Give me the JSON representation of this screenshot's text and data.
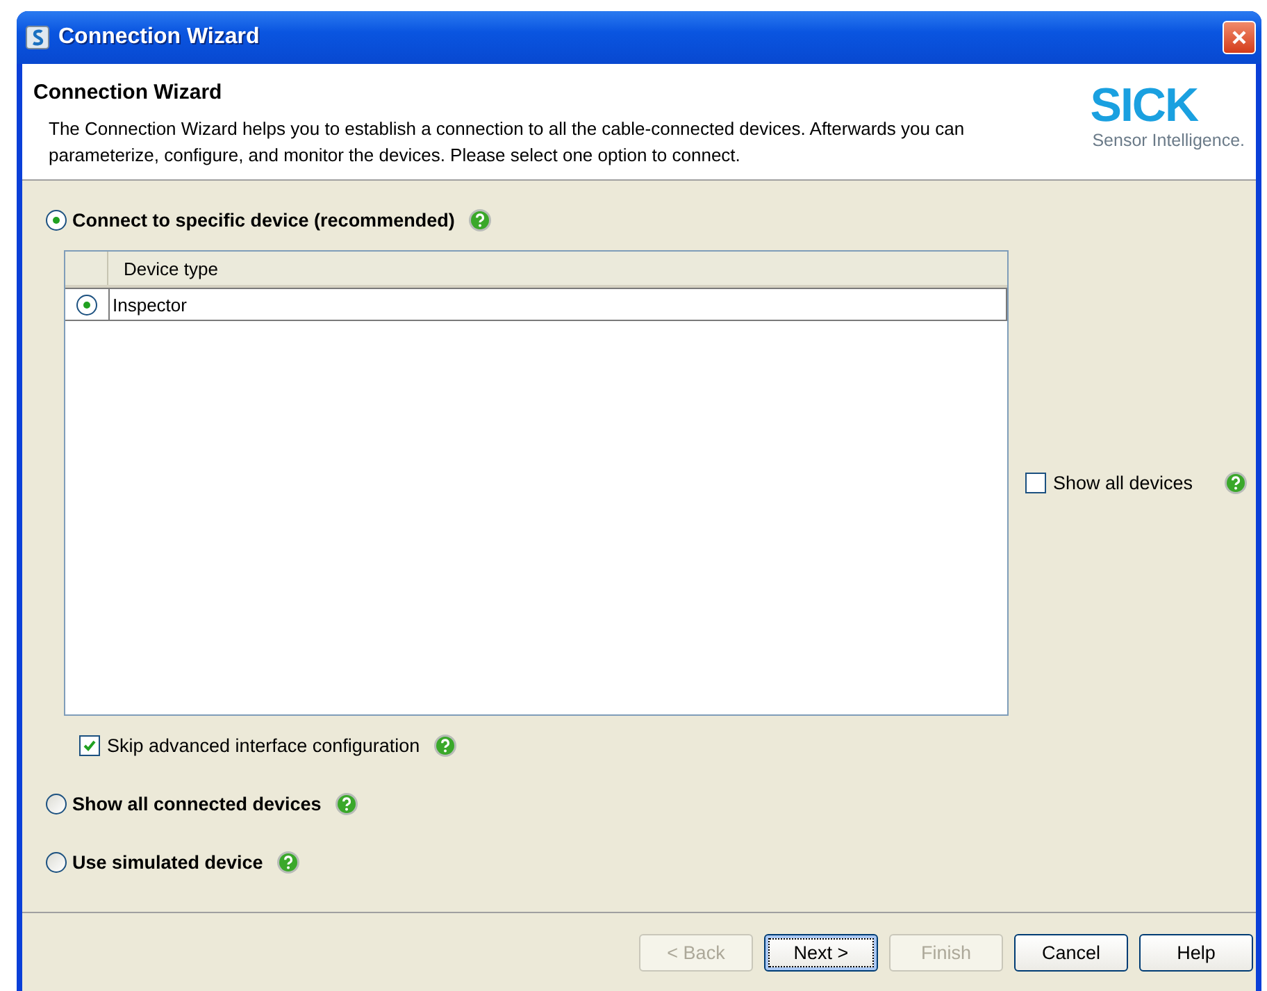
{
  "window": {
    "title": "Connection Wizard"
  },
  "header": {
    "title": "Connection Wizard",
    "description": "The Connection Wizard helps you to establish a connection to all the cable-connected devices. Afterwards you can parameterize, configure, and monitor the devices. Please select one option to connect.",
    "logo": {
      "name": "SICK",
      "tagline": "Sensor Intelligence."
    }
  },
  "options": [
    {
      "label": "Connect to specific device (recommended)",
      "selected": true
    },
    {
      "label": "Show all connected devices",
      "selected": false
    },
    {
      "label": "Use simulated device",
      "selected": false
    }
  ],
  "device_table": {
    "columns": [
      "Device type"
    ],
    "rows": [
      {
        "device_type": "Inspector",
        "selected": true
      }
    ]
  },
  "show_all_devices": {
    "label": "Show all devices",
    "checked": false
  },
  "skip_advanced": {
    "label": "Skip advanced interface configuration",
    "checked": true
  },
  "buttons": [
    {
      "label": "< Back",
      "disabled": true,
      "focused": false
    },
    {
      "label": "Next >",
      "disabled": false,
      "focused": true
    },
    {
      "label": "Finish",
      "disabled": true,
      "focused": false
    },
    {
      "label": "Cancel",
      "disabled": false,
      "focused": false
    },
    {
      "label": "Help",
      "disabled": false,
      "focused": false
    }
  ]
}
